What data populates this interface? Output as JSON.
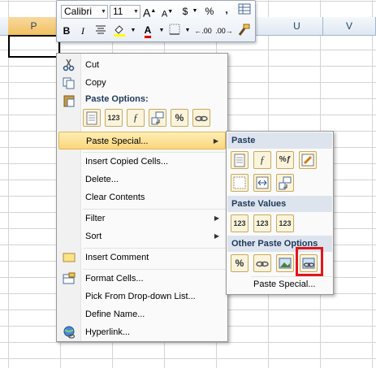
{
  "sheet": {
    "columns": [
      "P",
      "U",
      "V"
    ]
  },
  "mini_toolbar": {
    "font_name": "Calibri",
    "font_size": "11",
    "grow_font": "A",
    "shrink_font": "A",
    "currency": "$",
    "percent": "%",
    "comma": ",",
    "bold": "B",
    "italic": "I",
    "font_color": "A",
    "decrease_decimal": "←.00",
    "increase_decimal": ".00→"
  },
  "context_menu": {
    "cut": "Cut",
    "copy": "Copy",
    "paste_options_header": "Paste Options:",
    "paste_special": "Paste Special...",
    "insert_copied_cells": "Insert Copied Cells...",
    "delete": "Delete...",
    "clear_contents": "Clear Contents",
    "filter": "Filter",
    "sort": "Sort",
    "insert_comment": "Insert Comment",
    "format_cells": "Format Cells...",
    "pick_dropdown": "Pick From Drop-down List...",
    "define_name": "Define Name...",
    "hyperlink": "Hyperlink..."
  },
  "submenu": {
    "paste_header": "Paste",
    "paste_values_header": "Paste Values",
    "other_paste_header": "Other Paste Options",
    "paste_special_link": "Paste Special...",
    "btn_123": "123"
  },
  "colors": {
    "accent_highlight": "#e3161a",
    "menu_hover": "#fbd67c",
    "header_band": "#dde4ee"
  }
}
